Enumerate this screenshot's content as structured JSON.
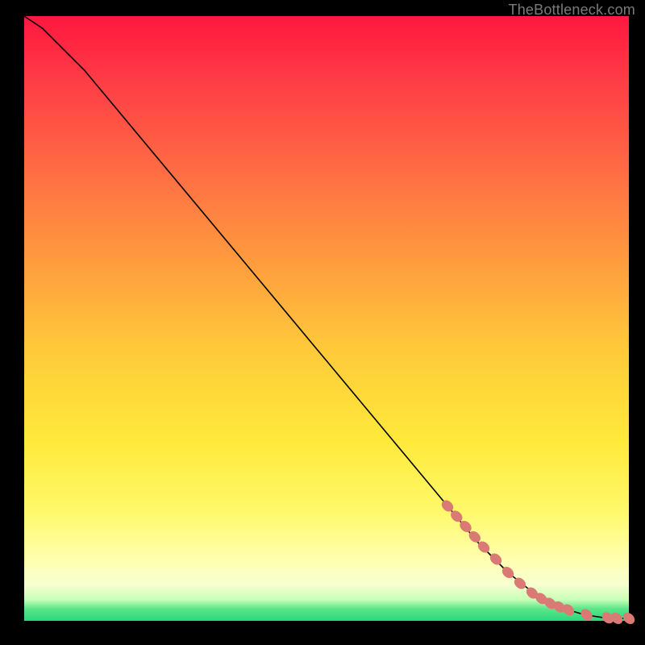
{
  "watermark": "TheBottleneck.com",
  "colors": {
    "curve": "#000000",
    "marker_fill": "#d97a74",
    "marker_stroke": "#c0645e"
  },
  "chart_data": {
    "type": "line",
    "title": "",
    "xlabel": "",
    "ylabel": "",
    "xlim": [
      0,
      100
    ],
    "ylim": [
      0,
      100
    ],
    "grid": false,
    "legend": false,
    "series": [
      {
        "name": "curve",
        "x": [
          0,
          3,
          6,
          10,
          15,
          20,
          30,
          40,
          50,
          60,
          70,
          75,
          80,
          85,
          88,
          90,
          92,
          94,
          96,
          98,
          100
        ],
        "y": [
          100,
          98,
          95,
          91,
          85,
          79,
          67,
          55,
          43,
          31,
          19,
          13,
          8,
          4,
          2.5,
          1.8,
          1.2,
          0.8,
          0.5,
          0.4,
          0.4
        ]
      }
    ],
    "markers": {
      "name": "highlighted-points",
      "x": [
        70,
        71.5,
        73,
        74.5,
        76,
        78,
        80,
        82,
        84,
        85.5,
        87,
        88.5,
        90,
        93,
        96.5,
        98,
        100
      ],
      "y": [
        19,
        17.3,
        15.6,
        13.9,
        12.2,
        10.2,
        8,
        6.2,
        4.6,
        3.7,
        2.9,
        2.3,
        1.8,
        1.0,
        0.5,
        0.4,
        0.4
      ]
    }
  }
}
